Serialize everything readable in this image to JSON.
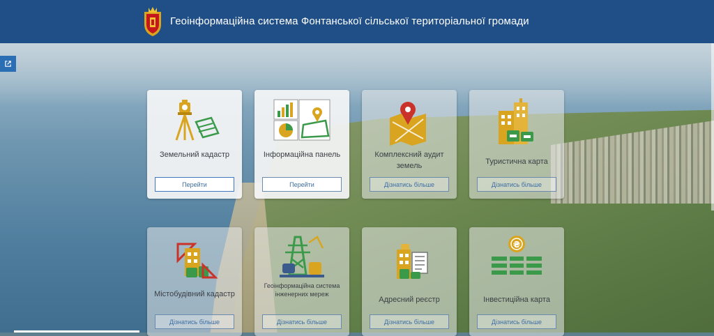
{
  "header": {
    "title": "Геоінформаційна система Фонтанської сільської територіальної громади",
    "logo_icon": "coat-of-arms-icon"
  },
  "colors": {
    "header_bg": "#1f4f86",
    "accent_gold": "#d9a520",
    "accent_green": "#3a9a4a",
    "button_text": "#3d6da3"
  },
  "sidebar": {
    "external_link_icon": "external-link-icon"
  },
  "cards": [
    {
      "label": "Земельний кадастр",
      "button": "Перейти",
      "icon": "surveyor-tripod-icon"
    },
    {
      "label": "Інформаційна панель",
      "button": "Перейти",
      "icon": "dashboard-charts-icon"
    },
    {
      "label": "Комплексний аудит земель",
      "button": "Дізнатись більше",
      "icon": "map-pin-icon"
    },
    {
      "label": "Туристична карта",
      "button": "Дізнатись більше",
      "icon": "tourist-buildings-icon"
    },
    {
      "label": "Містобудівний кадастр",
      "button": "Дізнатись більше",
      "icon": "urban-planning-icon"
    },
    {
      "label": "Геоінформаційна система інженерних мереж",
      "button": "Дізнатись більше",
      "icon": "power-tower-icon"
    },
    {
      "label": "Адресний реєстр",
      "button": "Дізнатись більше",
      "icon": "address-register-icon"
    },
    {
      "label": "Інвестиційна карта",
      "button": "Дізнатись більше",
      "icon": "investment-coin-icon"
    }
  ]
}
